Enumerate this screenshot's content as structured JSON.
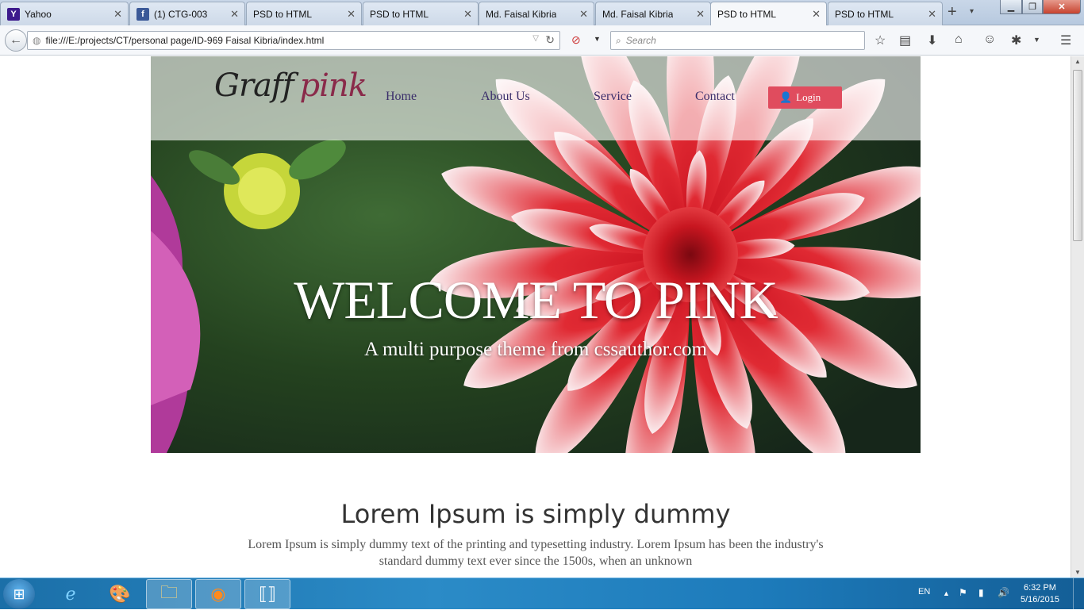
{
  "browser": {
    "tabs": [
      {
        "title": "Yahoo",
        "icon": "yahoo-icon",
        "active": false
      },
      {
        "title": "(1) CTG-003",
        "icon": "facebook-icon",
        "active": false
      },
      {
        "title": "PSD to HTML",
        "active": false
      },
      {
        "title": "PSD to HTML",
        "active": false
      },
      {
        "title": "Md. Faisal Kibria",
        "active": false
      },
      {
        "title": "Md. Faisal Kibria",
        "active": false
      },
      {
        "title": "PSD to HTML",
        "active": true
      },
      {
        "title": "PSD to HTML",
        "active": false
      }
    ],
    "url": "file:///E:/projects/CT/personal page/ID-969 Faisal Kibria/index.html",
    "search_placeholder": "Search",
    "colors": {
      "chrome": "#c9d7e8",
      "close_button": "#c7432f"
    }
  },
  "page": {
    "logo": {
      "part1": "Graff",
      "part2": "pink"
    },
    "nav": [
      "Home",
      "About Us",
      "Service",
      "Contact"
    ],
    "login_label": "Login",
    "hero": {
      "title": "WELCOME TO PINK",
      "subtitle": "A multi purpose theme from cssauthor.com"
    },
    "section": {
      "heading": "Lorem Ipsum is simply dummy",
      "text_line1": "Lorem Ipsum is simply dummy text of the printing and typesetting industry. Lorem Ipsum has been the industry's",
      "text_line2": "standard dummy text ever since the 1500s, when an unknown"
    },
    "colors": {
      "nav_text": "#3a2d6a",
      "login_bg": "#e04c5e",
      "logo_accent": "#8a2a4a"
    }
  },
  "taskbar": {
    "language": "EN",
    "time": "6:32 PM",
    "date": "5/16/2015",
    "apps": [
      "internet-explorer-icon",
      "paint-icon",
      "file-explorer-icon",
      "firefox-icon",
      "brackets-icon"
    ]
  }
}
